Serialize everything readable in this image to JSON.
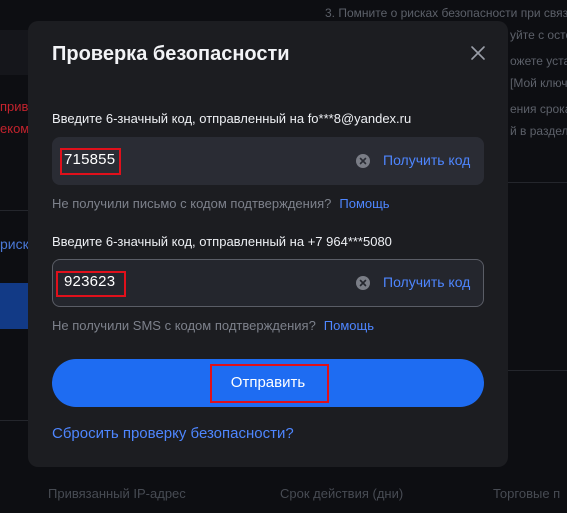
{
  "background": {
    "right_first_line": "3. Помните о рисках безопасности при связ",
    "right_fragments": [
      "уйте с осто",
      "ожете уста",
      "[Мой ключ",
      "ения срока",
      "й в раздел"
    ],
    "left_fragments": [
      "прив",
      "еком",
      "риск"
    ],
    "footer": [
      "Привязанный IP-адрес",
      "Срок действия (дни)",
      "Торговые п"
    ]
  },
  "modal": {
    "title": "Проверка безопасности",
    "email_field": {
      "label": "Введите 6-значный код, отправленный на fo***8@yandex.ru",
      "value": "715855",
      "get_code": "Получить код",
      "help_text": "Не получили письмо с кодом подтверждения?",
      "help_link": "Помощь"
    },
    "phone_field": {
      "label": "Введите 6-значный код, отправленный на +7 964***5080",
      "value": "923623",
      "get_code": "Получить код",
      "help_text": "Не получили SMS с кодом подтверждения?",
      "help_link": "Помощь"
    },
    "submit_label": "Отправить",
    "reset_link": "Сбросить проверку безопасности?"
  },
  "colors": {
    "accent": "#1e6cf2",
    "link": "#4e86ff",
    "highlight": "#e0101b",
    "modal_bg": "#1c1d21"
  }
}
